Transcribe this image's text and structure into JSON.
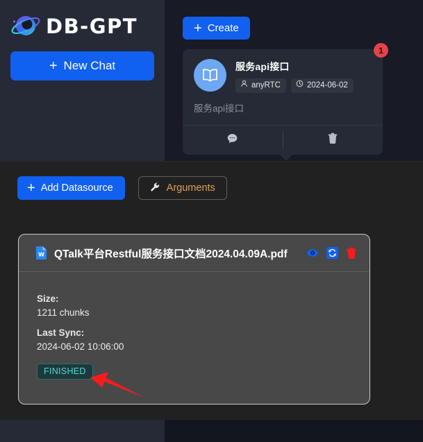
{
  "sidebar": {
    "brand_name": "DB-GPT",
    "logo_icon": "planet-logo-icon",
    "new_chat_label": "New Chat",
    "new_chat_plus": "+"
  },
  "top_panel": {
    "create_label": "Create",
    "create_plus": "+",
    "knowledge_card": {
      "badge_count": "1",
      "avatar_icon": "open-book-icon",
      "title": "服务api接口",
      "owner_icon": "user-icon",
      "owner": "anyRTC",
      "date_icon": "clock-icon",
      "date": "2024-06-02",
      "description": "服务api接口",
      "chat_icon": "chat-bubble-icon",
      "delete_icon": "trash-icon"
    }
  },
  "main": {
    "toolbar": {
      "add_datasource_label": "Add Datasource",
      "add_datasource_plus": "+",
      "arguments_label": "Arguments",
      "arguments_icon": "wrench-icon"
    },
    "document": {
      "file_icon": "word-document-icon",
      "file_name": "QTalk平台Restful服务接口文档2024.04.09A.pdf",
      "view_icon": "eye-icon",
      "sync_icon": "sync-icon",
      "delete_icon": "trash-icon",
      "size_label": "Size:",
      "size_value": "1211 chunks",
      "last_sync_label": "Last Sync:",
      "last_sync_value": "2024-06-02 10:06:00",
      "status": "FINISHED"
    },
    "annotation": {
      "arrow_icon": "red-arrow-icon"
    }
  },
  "colors": {
    "accent_blue": "#1160f0",
    "sidebar_bg": "#252a36",
    "panel_bg": "#181a25",
    "main_bg": "#212121",
    "card_bg": "#484848",
    "badge_red": "#e4434a",
    "status_teal": "#59d7d9",
    "arguments_orange": "#e0a05c",
    "annotation_red": "#fb1b1b"
  }
}
